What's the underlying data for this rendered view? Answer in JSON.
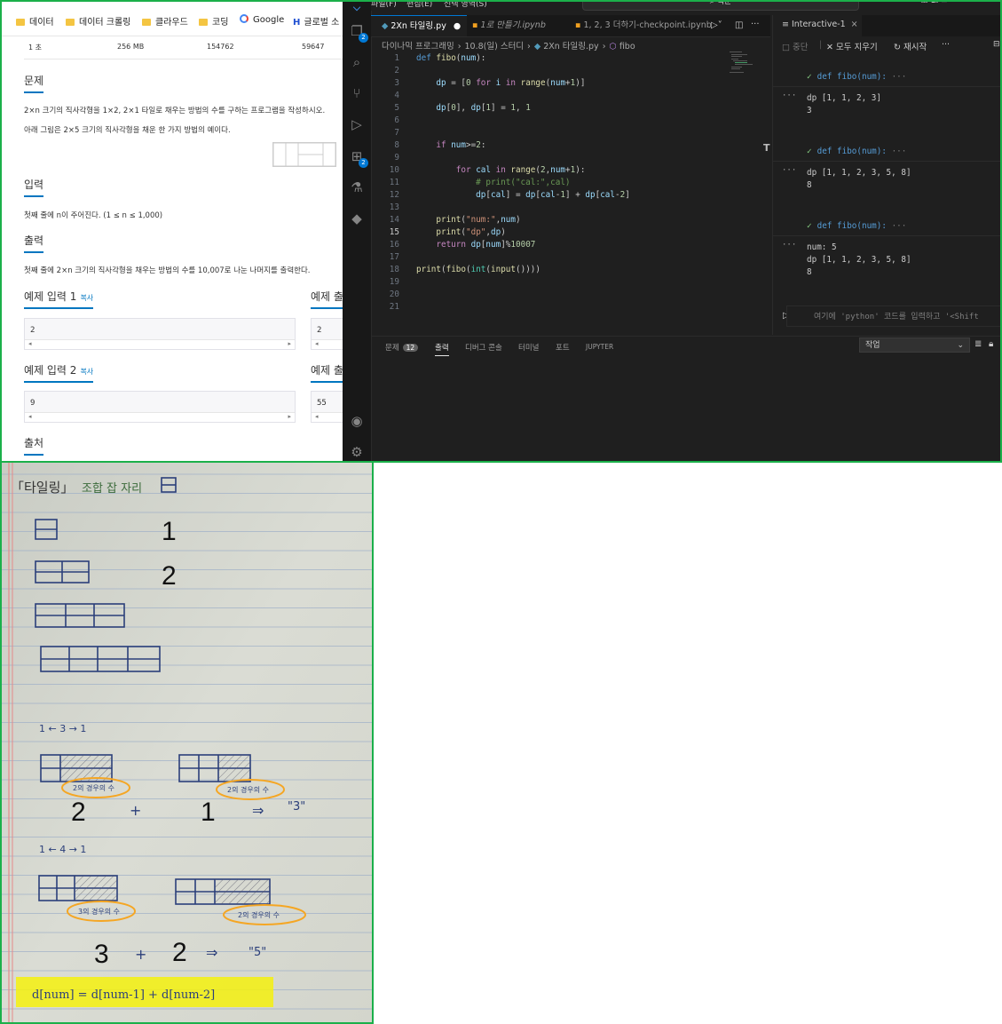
{
  "browser": {
    "bookmarks": [
      {
        "label": "데이터",
        "icon": "folder-icon"
      },
      {
        "label": "데이터 크롤링",
        "icon": "folder-icon"
      },
      {
        "label": "클라우드",
        "icon": "folder-icon"
      },
      {
        "label": "코딩",
        "icon": "folder-icon"
      },
      {
        "label": "Google",
        "icon": "google-icon"
      },
      {
        "label": "글로벌 소",
        "icon": "h-icon"
      }
    ],
    "stats": [
      "1 초",
      "256 MB",
      "154762",
      "59647"
    ],
    "problem": {
      "heading": "문제",
      "line1": "2×n 크기의 직사각형을 1×2, 2×1 타일로 채우는 방법의 수를 구하는 프로그램을 작성하시오.",
      "line2": "아래 그림은 2×5 크기의 직사각형을 채운 한 가지 방법의 예이다."
    },
    "input": {
      "heading": "입력",
      "text": "첫째 줄에 n이 주어진다. (1 ≤ n ≤ 1,000)"
    },
    "output": {
      "heading": "출력",
      "text": "첫째 줄에 2×n 크기의 직사각형을 채우는 방법의 수를 10,007로 나눈 나머지를 출력한다."
    },
    "samples": [
      {
        "title": "예제 입력 1",
        "copy": "복사",
        "value": "2"
      },
      {
        "title": "예제 출",
        "value": "2"
      },
      {
        "title": "예제 입력 2",
        "copy": "복사",
        "value": "9"
      },
      {
        "title": "예제 출",
        "value": "55"
      }
    ],
    "source_heading": "출처"
  },
  "vscode": {
    "menu": [
      "파일(F)",
      "편집(E)",
      "선택 영역(S)",
      "···"
    ],
    "search_label": "백준",
    "tabs": [
      {
        "label": "2Xn 타일링.py",
        "active": true
      },
      {
        "label": "1로 만들기.ipynb",
        "active": false
      },
      {
        "label": "1, 2, 3 더하기-checkpoint.ipynb",
        "active": false
      }
    ],
    "interactive_tab": "Interactive-1",
    "breadcrumb": [
      "다이나믹 프로그래밍",
      "10.8(일) 스터디",
      "2Xn 타일링.py",
      "fibo"
    ],
    "activity_badges": {
      "explorer": "2",
      "extensions": "2"
    },
    "current_line": 15,
    "interactive_toolbar": [
      "중단",
      "모두 지우기",
      "재시작",
      "···"
    ],
    "cells": [
      {
        "header": "def fibo(num):",
        "output": [
          "dp [1, 1, 2, 3]",
          "3"
        ]
      },
      {
        "header": "def fibo(num):",
        "output": [
          "dp [1, 1, 2, 3, 5, 8]",
          "8"
        ]
      },
      {
        "header": "def fibo(num):",
        "output": [
          "num: 5",
          "dp [1, 1, 2, 3, 5, 8]",
          "8"
        ]
      }
    ],
    "input_placeholder": "여기에 'python' 코드를 입력하고 '<Shift",
    "panel_tabs": [
      "문제",
      "출력",
      "디버그 콘솔",
      "터미널",
      "포트",
      "JUPYTER"
    ],
    "problems_count": "12",
    "output_select": "작업"
  },
  "notebook": {
    "title": "「타일링」",
    "subtitle": "조합 잡 자리",
    "labels": [
      "1",
      "2",
      "2",
      "1",
      "3",
      "2"
    ],
    "notes": [
      "1 ← 3 → 1",
      "1 ← 4 → 1",
      "2의 경우의 수",
      "2의 경우의 수",
      "3의 경우의 수",
      "2의 경우의 수",
      "\"3\"",
      "\"5\""
    ],
    "formula": "d[num] = d[num-1] + d[num-2]"
  },
  "colors": {
    "frame": "#1bb04a",
    "highlight": "#f5f10e",
    "accent": "#0078d4",
    "orange": "#f5a623"
  }
}
